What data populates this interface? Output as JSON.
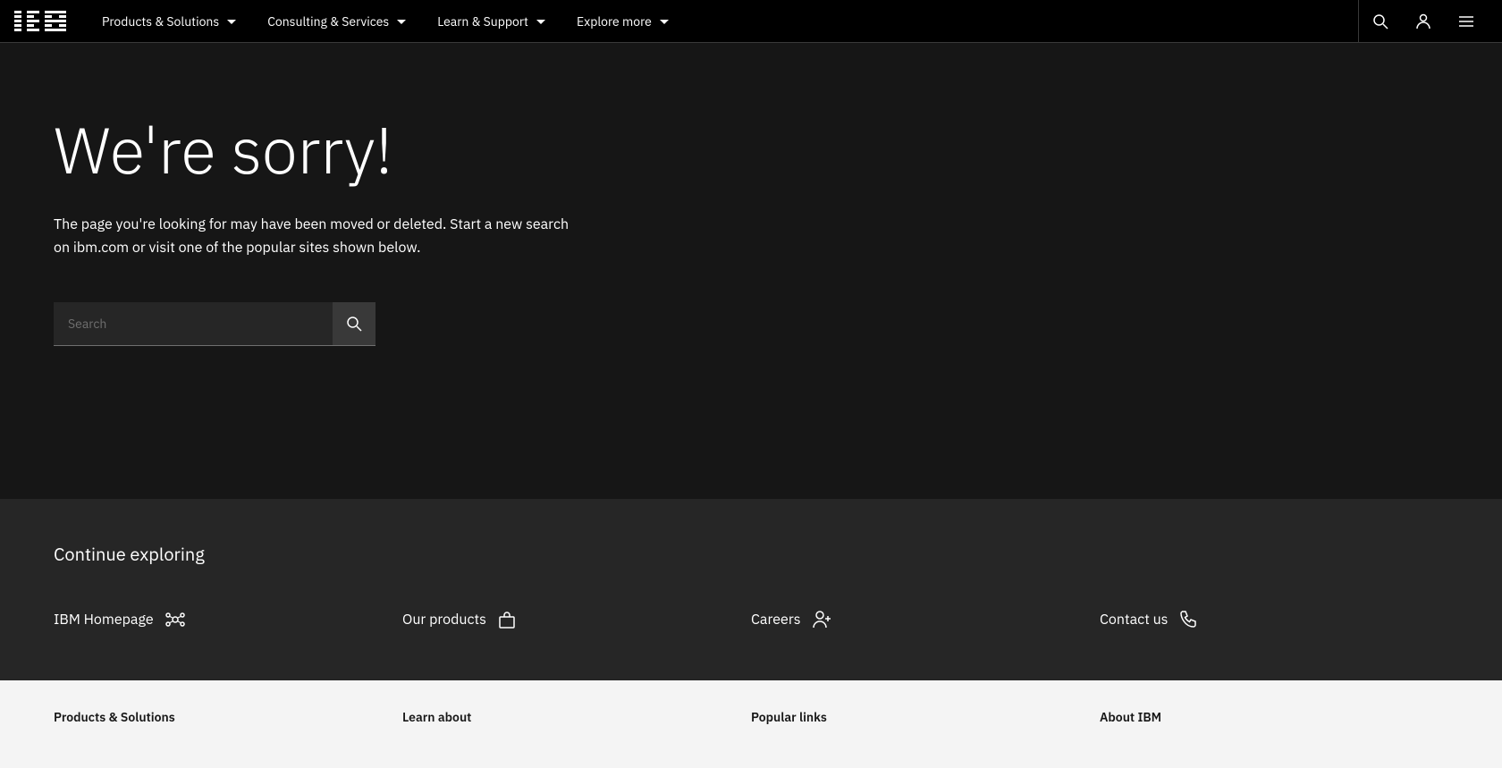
{
  "navbar": {
    "logo_alt": "IBM",
    "nav_items": [
      {
        "label": "Products & Solutions",
        "id": "products-solutions"
      },
      {
        "label": "Consulting & Services",
        "id": "consulting-services"
      },
      {
        "label": "Learn & Support",
        "id": "learn-support"
      },
      {
        "label": "Explore more",
        "id": "explore-more"
      }
    ],
    "search_aria": "Search",
    "user_aria": "User profile",
    "menu_aria": "Open menu"
  },
  "main": {
    "title": "We're sorry!",
    "description": "The page you're looking for may have been moved or deleted. Start a new search on ibm.com or visit one of the popular sites shown below.",
    "search_placeholder": "Search"
  },
  "continue": {
    "title": "Continue exploring",
    "links": [
      {
        "label": "IBM Homepage",
        "id": "ibm-homepage"
      },
      {
        "label": "Our products",
        "id": "our-products"
      },
      {
        "label": "Careers",
        "id": "careers"
      },
      {
        "label": "Contact us",
        "id": "contact-us"
      }
    ]
  },
  "footer": {
    "columns": [
      {
        "title": "Products & Solutions",
        "id": "footer-products"
      },
      {
        "title": "Learn about",
        "id": "footer-learn"
      },
      {
        "title": "Popular links",
        "id": "footer-popular"
      },
      {
        "title": "About IBM",
        "id": "footer-about"
      }
    ]
  }
}
